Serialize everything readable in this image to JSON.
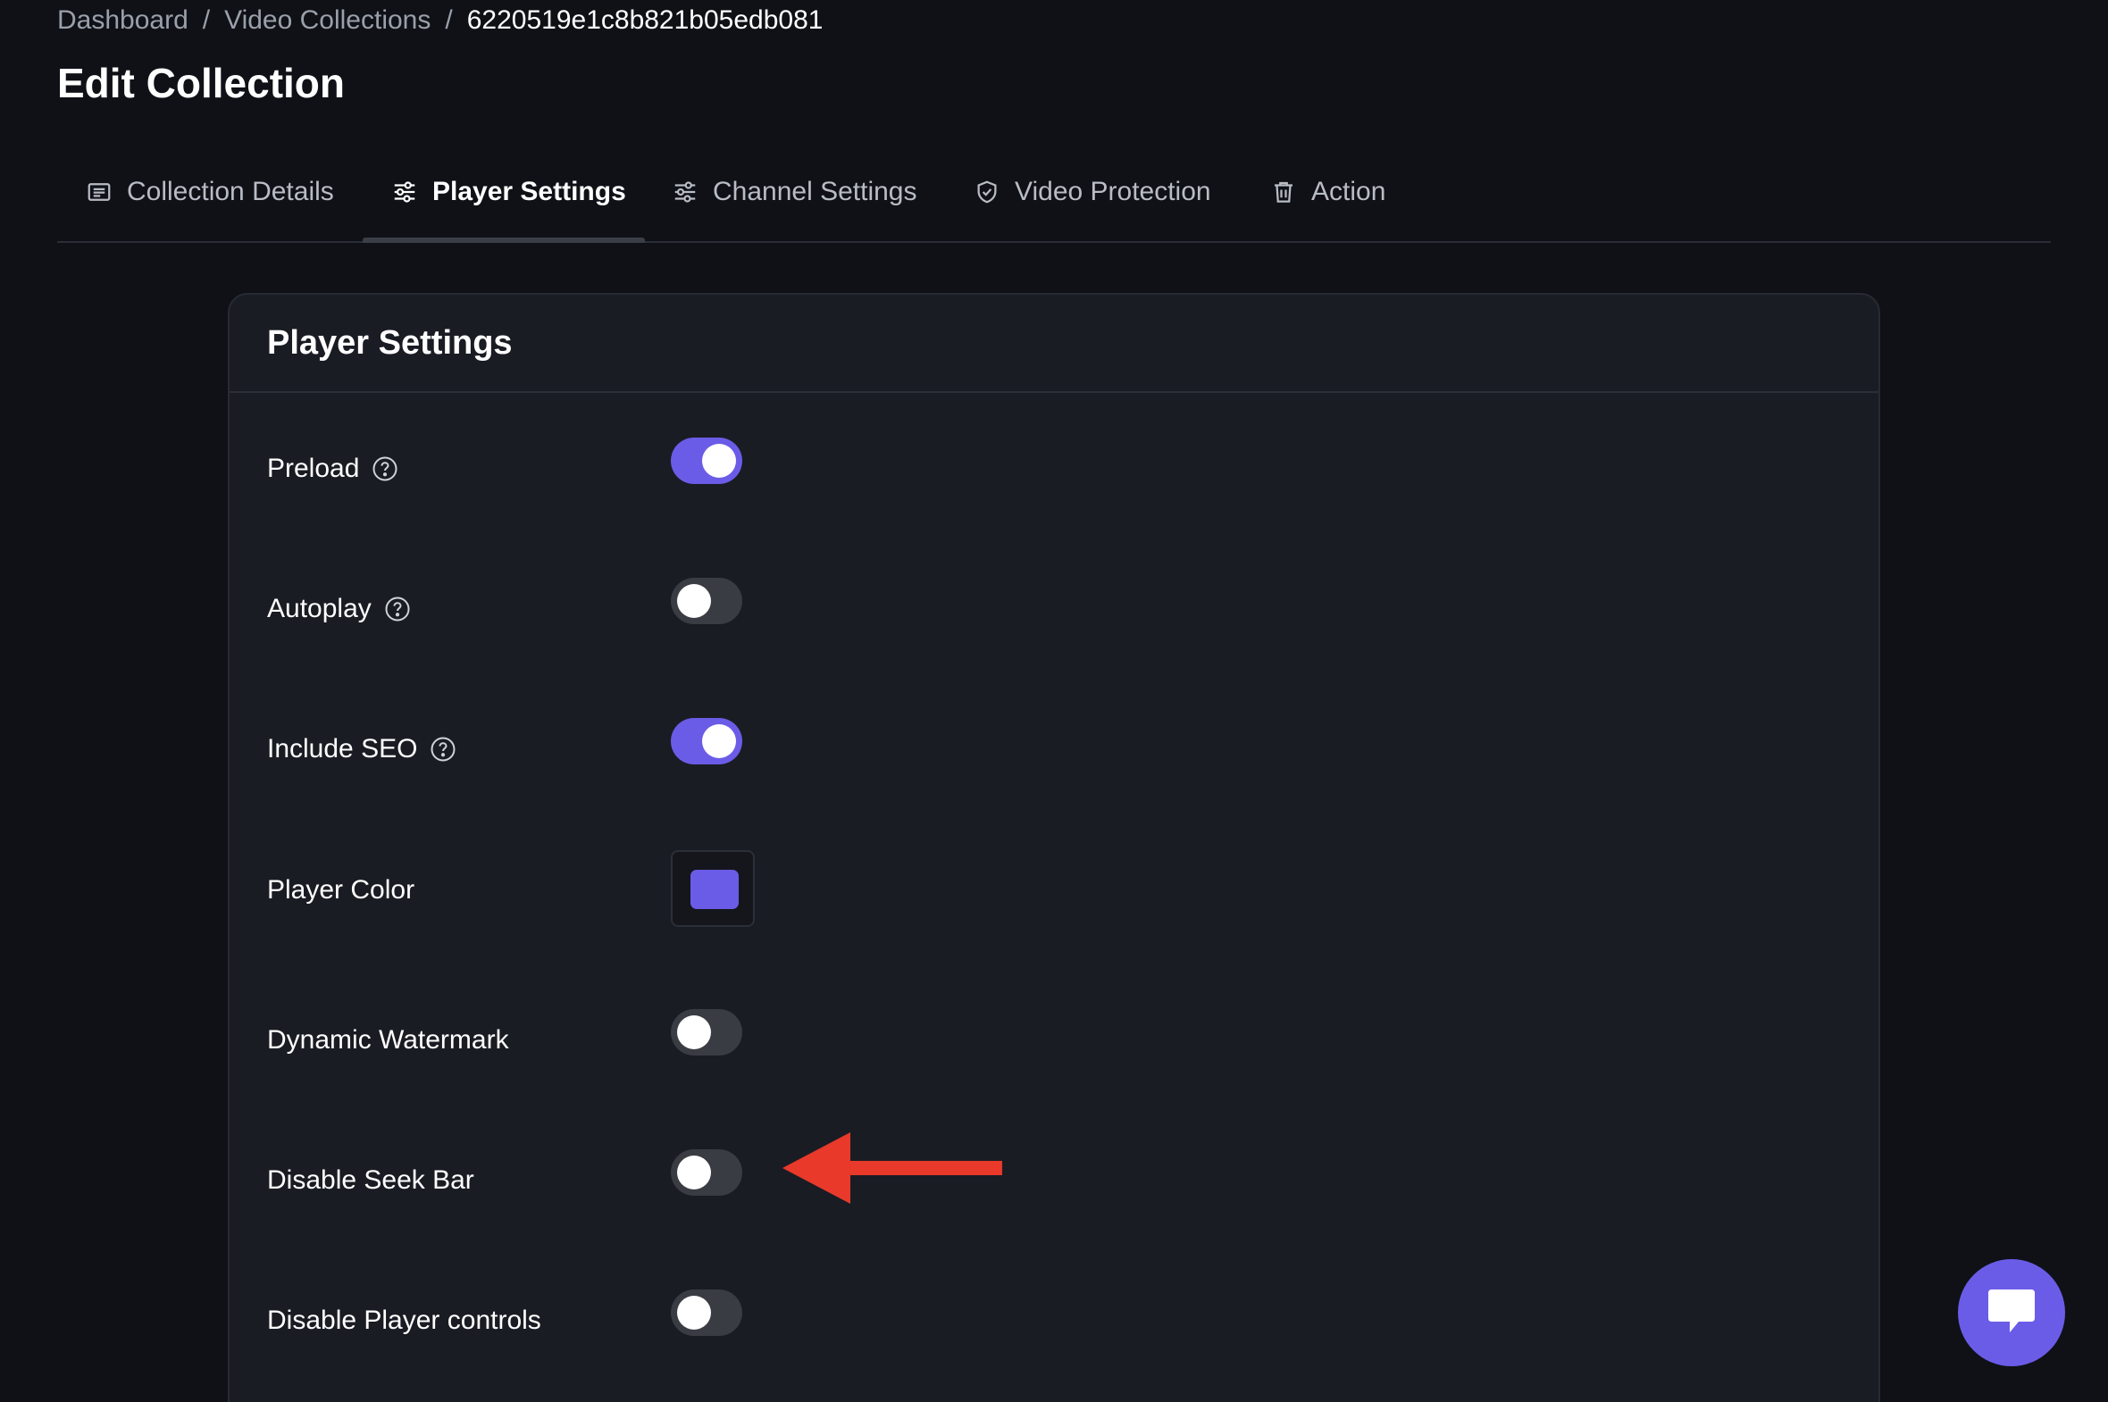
{
  "breadcrumb": {
    "items": [
      "Dashboard",
      "Video Collections"
    ],
    "separator": "/",
    "current": "6220519e1c8b821b05edb081"
  },
  "page": {
    "title": "Edit Collection"
  },
  "tabs": [
    {
      "label": "Collection Details",
      "icon": "document-list-icon",
      "active": false
    },
    {
      "label": "Player Settings",
      "icon": "sliders-icon",
      "active": true
    },
    {
      "label": "Channel Settings",
      "icon": "sliders-icon",
      "active": false
    },
    {
      "label": "Video Protection",
      "icon": "shield-check-icon",
      "active": false
    },
    {
      "label": "Action",
      "icon": "trash-icon",
      "active": false
    }
  ],
  "card": {
    "title": "Player Settings",
    "settings": [
      {
        "label": "Preload",
        "type": "toggle",
        "on": true,
        "help": true
      },
      {
        "label": "Autoplay",
        "type": "toggle",
        "on": false,
        "help": true
      },
      {
        "label": "Include SEO",
        "type": "toggle",
        "on": true,
        "help": true
      },
      {
        "label": "Player Color",
        "type": "color",
        "value": "#6b5ce7",
        "help": false
      },
      {
        "label": "Dynamic Watermark",
        "type": "toggle",
        "on": false,
        "help": false
      },
      {
        "label": "Disable Seek Bar",
        "type": "toggle",
        "on": false,
        "help": false
      },
      {
        "label": "Disable Player controls",
        "type": "toggle",
        "on": false,
        "help": false
      }
    ]
  },
  "annotation": {
    "arrow_color": "#e8392b"
  },
  "colors": {
    "accent": "#6b5ce7",
    "background": "#0f1117",
    "card": "#1a1c23",
    "toggle_off": "#3a3c43"
  },
  "chat": {
    "icon": "chat-bubble-icon"
  }
}
